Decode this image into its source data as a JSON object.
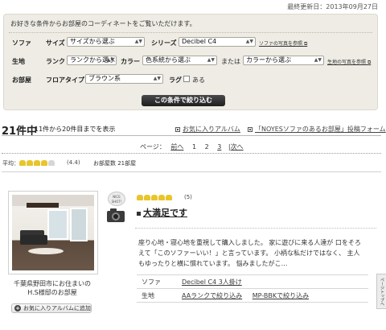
{
  "updated": "最終更新日：2013年09月27日",
  "filter": {
    "intro": "お好きな条件からお部屋のコーディネートをご覧いただけます。",
    "sofa": {
      "label": "ソファ",
      "size_label": "サイズ",
      "size_value": "サイズから選ぶ",
      "series_label": "シリーズ",
      "series_value": "Decibel C4",
      "photo_link": "ソファの写真を参照"
    },
    "fabric": {
      "label": "生地",
      "rank_label": "ランク",
      "rank_value": "ランクから選ぶ",
      "color_label": "カラー",
      "color_value": "色系統から選ぶ",
      "or_text": "または",
      "color2_value": "カラーから選ぶ",
      "photo_link": "生地の写真を参照"
    },
    "room": {
      "label": "お部屋",
      "floor_label": "フロアタイプ",
      "floor_value": "ブラウン系",
      "rug_label": "ラグ",
      "rug_check_label": "ある"
    },
    "apply": "この条件で絞り込む"
  },
  "results": {
    "total": "21件中",
    "range": "11件から20件目までを表示",
    "fav_album": "お気に入りアルバム",
    "post_form": "「NOYESソファのあるお部屋」投稿フォーム"
  },
  "pager": {
    "label": "ページ：",
    "prev": "前へ",
    "pages": [
      "1",
      "2",
      "3"
    ],
    "next": "次へ"
  },
  "average": {
    "label": "平均：",
    "rating": 4.4,
    "rating_text": "(4.4)",
    "room_count": "お部屋数 21部屋"
  },
  "review": {
    "photo_caption_line1": "千葉県野田市にお住まいの",
    "photo_caption_line2": "H.S様邸のお部屋",
    "fav_button": "お気に入りアルバムに追加",
    "badge": "NICE SHOT!",
    "rating": 5,
    "rating_text": "(5)",
    "title": "大満足です",
    "body": "座り心地・寝心地を重視して購入しました。 家に遊びに来る人達が 口をそろえて「このソファーいい！」と言っています。 小柄な私だけではなく、 主人もゆったりと横に慣れています。 悩みましたがこ…",
    "spec_rows": [
      {
        "key": "ソファ",
        "value": "Decibel C4 3人掛け",
        "link2": ""
      },
      {
        "key": "生地",
        "value": "AAランクで絞り込み",
        "link2": "MP-BBKで絞り込み"
      }
    ]
  },
  "side_tab": "ページトップへ"
}
